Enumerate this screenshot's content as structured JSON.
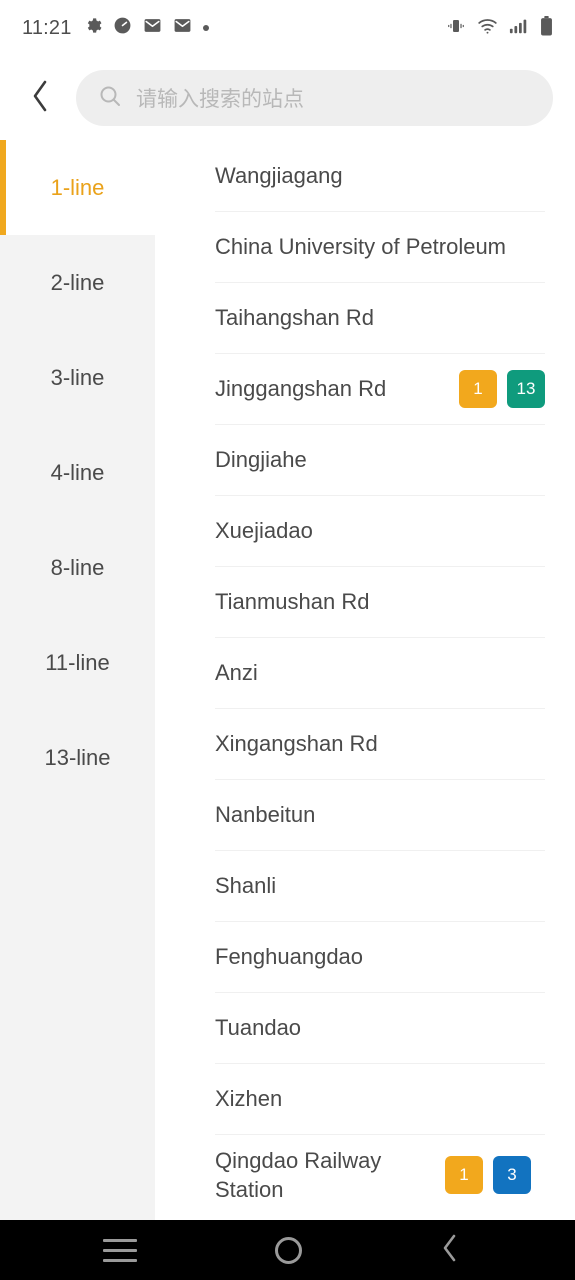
{
  "status_bar": {
    "time": "11:21",
    "left_icons": [
      "gear-icon",
      "speedometer-icon",
      "mail-icon",
      "mail-icon",
      "dot-icon"
    ],
    "right_icons": [
      "vibrate-icon",
      "wifi-icon",
      "cellular-signal-icon",
      "battery-icon"
    ]
  },
  "header": {
    "back_icon": "chevron-left-icon",
    "search": {
      "icon": "search-icon",
      "placeholder": "请输入搜索的站点",
      "value": ""
    }
  },
  "sidebar": {
    "selected_index": 0,
    "accent_color": "#f0a81e",
    "items": [
      {
        "label": "1-line"
      },
      {
        "label": "2-line"
      },
      {
        "label": "3-line"
      },
      {
        "label": "4-line"
      },
      {
        "label": "8-line"
      },
      {
        "label": "11-line"
      },
      {
        "label": "13-line"
      }
    ]
  },
  "line_colors": {
    "1": "#f2a81d",
    "3": "#1273c0",
    "13": "#0f9b7d"
  },
  "stations": [
    {
      "name": "Wangjiagang",
      "badges": []
    },
    {
      "name": "China University of Petroleum",
      "badges": []
    },
    {
      "name": "Taihangshan Rd",
      "badges": []
    },
    {
      "name": "Jinggangshan Rd",
      "badges": [
        {
          "label": "1",
          "color": "#f2a81d"
        },
        {
          "label": "13",
          "color": "#0f9b7d"
        }
      ]
    },
    {
      "name": "Dingjiahe",
      "badges": []
    },
    {
      "name": "Xuejiadao",
      "badges": []
    },
    {
      "name": "Tianmushan Rd",
      "badges": []
    },
    {
      "name": "Anzi",
      "badges": []
    },
    {
      "name": "Xingangshan Rd",
      "badges": []
    },
    {
      "name": "Nanbeitun",
      "badges": []
    },
    {
      "name": "Shanli",
      "badges": []
    },
    {
      "name": "Fenghuangdao",
      "badges": []
    },
    {
      "name": "Tuandao",
      "badges": []
    },
    {
      "name": "Xizhen",
      "badges": []
    },
    {
      "name": "Qingdao Railway Station",
      "badges": [
        {
          "label": "1",
          "color": "#f2a81d"
        },
        {
          "label": "3",
          "color": "#1273c0"
        }
      ]
    }
  ],
  "nav_bar": {
    "recents_icon": "menu-icon",
    "home_icon": "home-circle-icon",
    "back_icon": "chevron-left-icon"
  }
}
